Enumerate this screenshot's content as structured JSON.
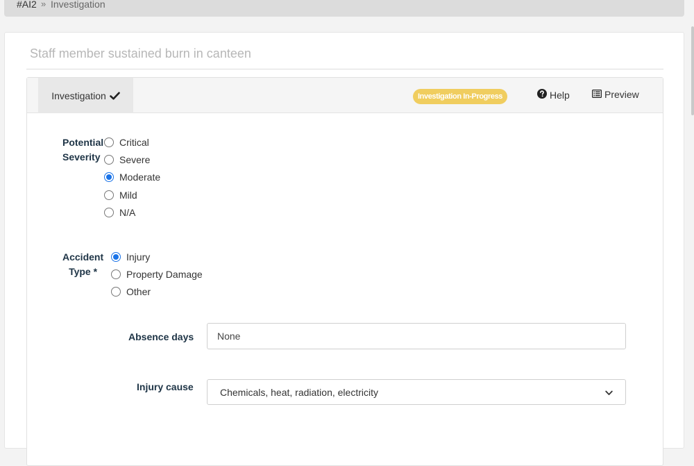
{
  "breadcrumb": {
    "root": "#AI2",
    "separator": "»",
    "current": "Investigation"
  },
  "page": {
    "title": "Staff member sustained burn in canteen"
  },
  "header": {
    "tab_label": "Investigation",
    "status_badge": "Investigation In-Progress",
    "status_color": "#f0cd5f",
    "help_label": "Help",
    "preview_label": "Preview"
  },
  "form": {
    "potential_severity": {
      "label_line1": "Potential",
      "label_line2": "Severity",
      "options": [
        "Critical",
        "Severe",
        "Moderate",
        "Mild",
        "N/A"
      ],
      "selected": "Moderate"
    },
    "accident_type": {
      "label_line1": "Accident",
      "label_line2": "Type *",
      "options": [
        "Injury",
        "Property Damage",
        "Other"
      ],
      "selected": "Injury"
    },
    "absence_days": {
      "label": "Absence days",
      "value": "None"
    },
    "injury_cause": {
      "label": "Injury cause",
      "value": "Chemicals, heat, radiation, electricity"
    }
  },
  "icons": {
    "check": "check-icon",
    "help": "question-circle-icon",
    "preview": "list-alt-icon",
    "dropdown": "chevron-down-icon"
  },
  "accent_color": "#1a73e8"
}
